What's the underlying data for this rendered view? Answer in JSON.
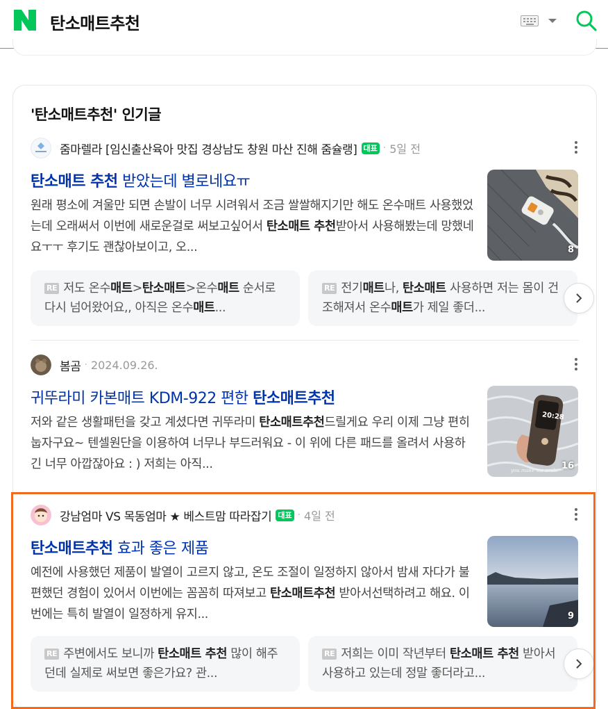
{
  "header": {
    "query": "탄소매트추천",
    "logo_icon": "naver-n-logo",
    "keyboard_icon": "keyboard-icon",
    "search_icon": "search-icon",
    "accent_color": "#03c75a"
  },
  "section": {
    "title": "'탄소매트추천' 인기글"
  },
  "posts": [
    {
      "author": "줌마렐라 [임신출산육아 맛집 경상남도 창원 마산 진해 줌슐랭]",
      "badge": "대표",
      "date": "5일 전",
      "title_bold": "탄소매트 추천",
      "title_rest": " 받았는데 별로네요ㅠ",
      "desc_parts": [
        "원래 평소에 겨울만 되면 손발이 너무 시려워서 조금 쌀쌀해지기만 해도 온수매트 사용했었는데 오래써서 이번에 새로운걸로 써보고싶어서 ",
        "탄소매트 추천",
        "받아서 사용해봤는데 망했네요ㅜㅜ 후기도 괜찮아보이고, 오..."
      ],
      "image_count": "8",
      "replies": [
        {
          "tag": "RE",
          "text": "저도 온수<b>매트</b>><b>탄소매트</b>>온수<b>매트</b> 순서로 다시 넘어왔어요,, 아직은 온수<b>매트</b>..."
        },
        {
          "tag": "RE",
          "text": "전기<b>매트</b>나, <b>탄소매트</b> 사용하면 저는 몸이 건조해져서 온수<b>매트</b>가 제일 좋더..."
        }
      ]
    },
    {
      "author": "봄곰",
      "badge": "",
      "date": "2024.09.26.",
      "title_bold": "",
      "title_rest": "귀뚜라미 카본매트 KDM-922 편한 ",
      "title_bold_end": "탄소매트추천",
      "desc_parts": [
        "저와 같은 생활패턴을 갖고 계셨다면 귀뚜라미 ",
        "탄소매트추천",
        "드릴게요 우리 이제 그냥 편히 눕자구요~ 텐셀원단을 이용하여 너무나 부드러워요 - 이 위에 다른 패드를 올려서 사용하긴 너무 아깝잖아요 : ) 저희는 아직..."
      ],
      "image_count": "16",
      "image_caption": "you make me smile",
      "device_time": "20:28"
    },
    {
      "author": "강남엄마 VS 목동엄마 ★ 베스트맘 따라잡기",
      "badge": "대표",
      "date": "4일 전",
      "title_bold": "탄소매트추천",
      "title_rest": " 효과 좋은 제품",
      "desc_parts": [
        "예전에 사용했던 제품이 발열이 고르지 않고, 온도 조절이 일정하지 않아서 밤새 자다가 불편했던 경험이 있어서 이번에는 꼼꼼히 따져보고 ",
        "탄소매트추천",
        " 받아서선택하려고 해요. 이번에는 특히 발열이 일정하게 유지..."
      ],
      "image_count": "9",
      "replies": [
        {
          "tag": "RE",
          "text": "주변에서도 보니까 <b>탄소매트 추천</b> 많이 해주던데 실제로 써보면 좋은가요? 관..."
        },
        {
          "tag": "RE",
          "text": "저희는 이미 작년부터 <b>탄소매트 추천</b> 받아서 사용하고 있는데 정말 좋더라고..."
        }
      ]
    }
  ],
  "colors": {
    "title_link": "#0033aa",
    "highlight_border": "#f26a1b"
  }
}
